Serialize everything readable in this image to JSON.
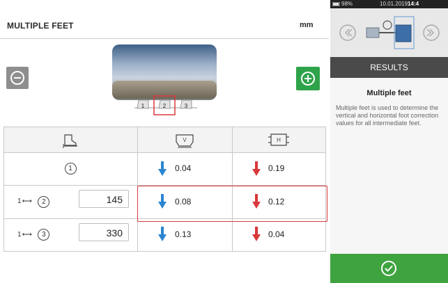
{
  "header": {
    "title": "MULTIPLE FEET",
    "unit": "mm"
  },
  "colors": {
    "accent_green": "#2fa34a",
    "arrow_blue": "#2a86d1",
    "arrow_red": "#d9383a",
    "highlight": "#d9383a"
  },
  "machine": {
    "feet_labels": [
      "1",
      "2",
      "3"
    ],
    "selected_foot": "2"
  },
  "table": {
    "columns": [
      {
        "icon": "foot-distance-icon"
      },
      {
        "icon": "vertical-view-icon"
      },
      {
        "icon": "horizontal-view-icon"
      }
    ],
    "rows": [
      {
        "index": "1",
        "prefix": "",
        "distance": "",
        "vertical": "0.04",
        "vertical_dir": "down",
        "horizontal": "0.19",
        "horizontal_dir": "down"
      },
      {
        "index": "2",
        "prefix": "1",
        "distance": "145",
        "vertical": "0.08",
        "vertical_dir": "down",
        "horizontal": "0.12",
        "horizontal_dir": "down"
      },
      {
        "index": "3",
        "prefix": "1",
        "distance": "330",
        "vertical": "0.13",
        "vertical_dir": "down",
        "horizontal": "0.04",
        "horizontal_dir": "down"
      }
    ],
    "highlighted_row_index": "2"
  },
  "sidebar": {
    "status": {
      "battery": "98%",
      "date": "10.01.2019",
      "time": "14:4"
    },
    "results_label": "RESULTS",
    "heading": "Multiple feet",
    "description": "Multiple feet is used to determine the vertical and horizontal foot correction values for all intermediate feet."
  }
}
